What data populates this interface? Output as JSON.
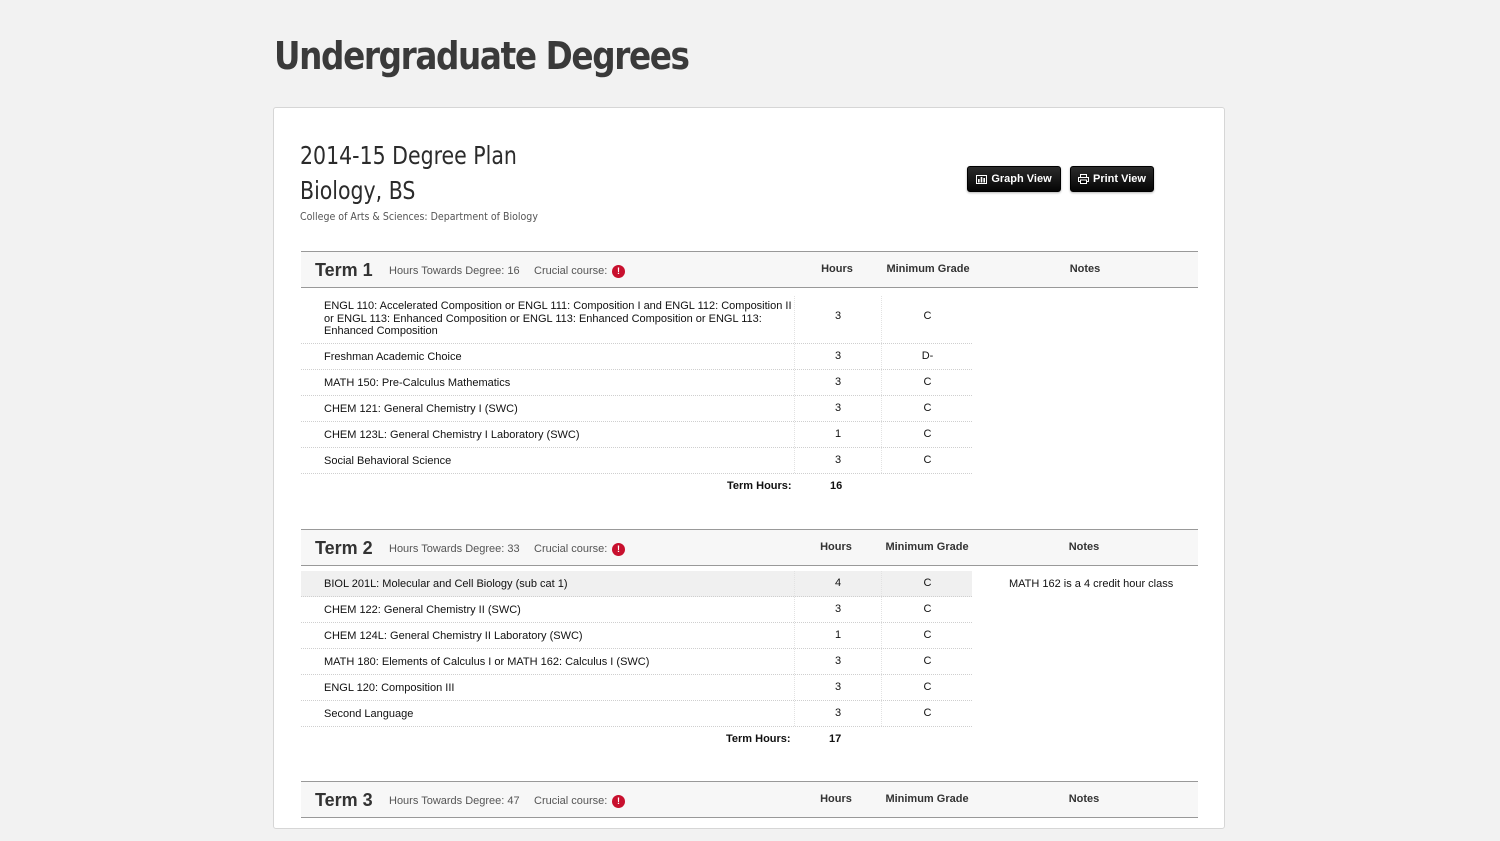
{
  "page": {
    "title": "Undergraduate Degrees"
  },
  "plan": {
    "title_line1": "2014-15 Degree Plan",
    "title_line2": "Biology, BS",
    "college": "College of Arts & Sciences: Department of Biology"
  },
  "buttons": {
    "graph_view": "Graph View",
    "print_view": "Print View"
  },
  "columns": {
    "hours": "Hours",
    "min_grade": "Minimum Grade",
    "notes": "Notes"
  },
  "labels": {
    "hours_towards": "Hours Towards Degree:",
    "crucial": "Crucial course:",
    "term_hours": "Term Hours:",
    "crucial_icon": "!"
  },
  "colors": {
    "crucial": "#c8102e",
    "button": "#111111"
  },
  "terms": [
    {
      "name": "Term 1",
      "hours_towards": "16",
      "term_hours": "16",
      "note": "",
      "courses": [
        {
          "course": "ENGL 110: Accelerated Composition or ENGL 111: Composition I and ENGL 112: Composition II or ENGL 113: Enhanced Composition or ENGL 113: Enhanced Composition or ENGL 113: Enhanced Composition",
          "hours": "3",
          "grade": "C"
        },
        {
          "course": "Freshman Academic Choice",
          "hours": "3",
          "grade": "D-"
        },
        {
          "course": "MATH 150: Pre-Calculus Mathematics",
          "hours": "3",
          "grade": "C"
        },
        {
          "course": "CHEM 121: General Chemistry I (SWC)",
          "hours": "3",
          "grade": "C"
        },
        {
          "course": "CHEM 123L: General Chemistry I Laboratory (SWC)",
          "hours": "1",
          "grade": "C"
        },
        {
          "course": "Social Behavioral Science",
          "hours": "3",
          "grade": "C"
        }
      ]
    },
    {
      "name": "Term 2",
      "hours_towards": "33",
      "term_hours": "17",
      "note": "MATH 162 is a 4 credit hour class",
      "courses": [
        {
          "course": "BIOL 201L: Molecular and Cell Biology (sub cat 1)",
          "hours": "4",
          "grade": "C"
        },
        {
          "course": "CHEM 122: General Chemistry II (SWC)",
          "hours": "3",
          "grade": "C"
        },
        {
          "course": "CHEM 124L: General Chemistry II Laboratory (SWC)",
          "hours": "1",
          "grade": "C"
        },
        {
          "course": "MATH 180: Elements of Calculus I or MATH 162: Calculus I (SWC)",
          "hours": "3",
          "grade": "C"
        },
        {
          "course": "ENGL 120: Composition III",
          "hours": "3",
          "grade": "C"
        },
        {
          "course": "Second Language",
          "hours": "3",
          "grade": "C"
        }
      ]
    },
    {
      "name": "Term 3",
      "hours_towards": "47"
    }
  ]
}
